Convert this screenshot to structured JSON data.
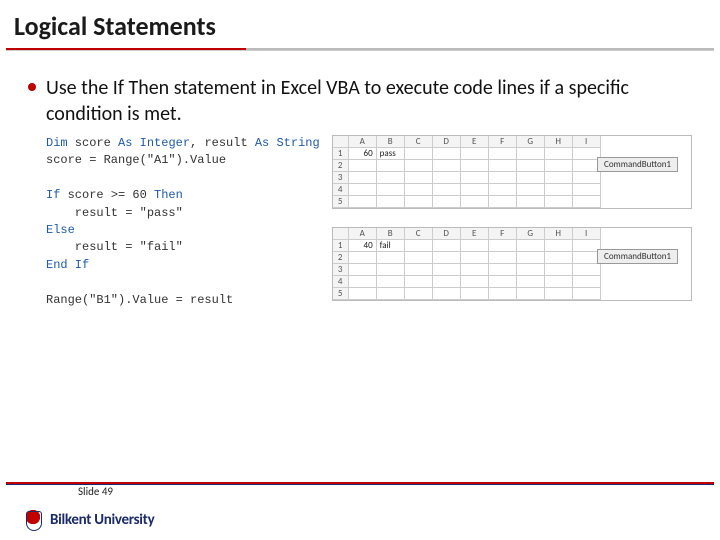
{
  "title": "Logical Statements",
  "bullet": "Use the If Then statement in Excel VBA to execute code lines if a specific condition is met.",
  "code": {
    "l1a": "Dim",
    "l1b": " score ",
    "l1c": "As Integer",
    "l1d": ", result ",
    "l1e": "As String",
    "l2": "score = Range(\"A1\").Value",
    "l3a": "If",
    "l3b": " score >= 60 ",
    "l3c": "Then",
    "l4": "    result = \"pass\"",
    "l5": "Else",
    "l6": "    result = \"fail\"",
    "l7": "End If",
    "l8": "Range(\"B1\").Value = result"
  },
  "sheets": {
    "cols": [
      "A",
      "B",
      "C",
      "D",
      "E",
      "F",
      "G",
      "H",
      "I"
    ],
    "rows": [
      "1",
      "2",
      "3",
      "4",
      "5"
    ],
    "top": {
      "a1": "60",
      "b1": "pass"
    },
    "bottom": {
      "a1": "40",
      "b1": "fail"
    },
    "button": "CommandButton1"
  },
  "footer": {
    "slide": "Slide 49",
    "uni": "Bilkent University"
  }
}
